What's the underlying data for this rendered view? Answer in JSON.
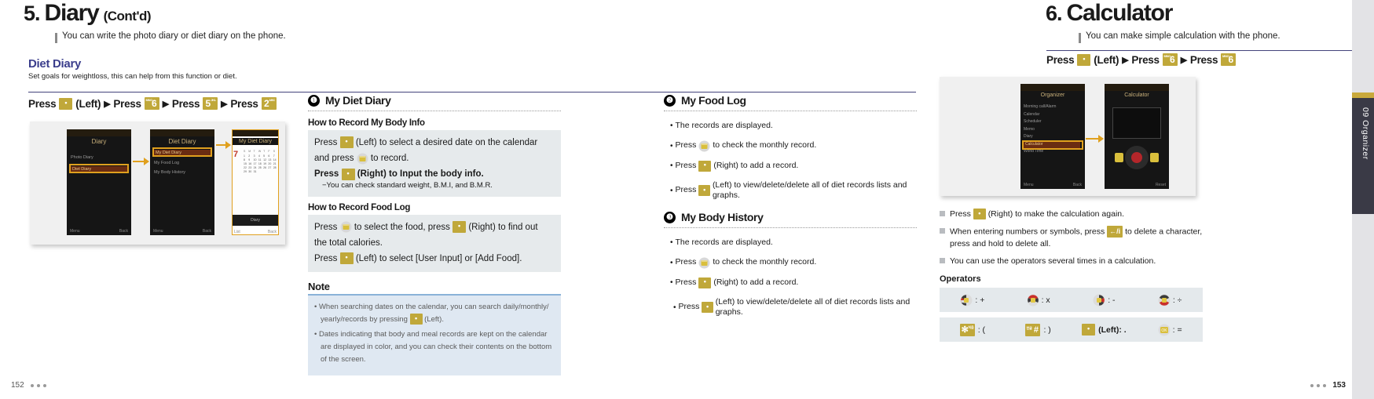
{
  "left": {
    "chapter_number": "5.",
    "chapter_title": "Diary",
    "chapter_cont": "(Cont'd)",
    "intro": "You can write the photo diary or diet diary on the phone.",
    "section_title": "Diet Diary",
    "section_desc": "Set goals for weightloss, this can help from this function or diet.",
    "press_path": {
      "press1": "Press",
      "left_label": "(Left)",
      "press2": "Press",
      "key6": "6",
      "key6_sub": "MNO",
      "press3": "Press",
      "key5": "5",
      "key5_sub": "JKL",
      "press4": "Press",
      "key2": "2",
      "key2_sub": "ABC",
      "arrow": "▶"
    },
    "screens": [
      {
        "title": "Diary",
        "rows": [
          "Photo Diary",
          "Diet Diary"
        ],
        "softkeys": [
          "Menu",
          "Back"
        ]
      },
      {
        "title": "Diet Diary",
        "rows": [
          "My Diet Diary",
          "My Food Log",
          "My Body History"
        ],
        "softkeys": [
          "Menu",
          "Back"
        ]
      },
      {
        "title": "My Diet Diary",
        "rows": [],
        "softkeys": [
          "List",
          "Back"
        ]
      }
    ]
  },
  "col2": {
    "item1": {
      "badge": "❶",
      "label": "My Diet Diary",
      "howto1": "How to Record My Body Info",
      "body1a_pre": "Press",
      "body1a_mid": "(Left) to select a desired date on the calendar and",
      "body1b_pre": "press",
      "body1b_post": "to record.",
      "body1c_pre": "Press",
      "body1c_post": "(Right) to Input the body info.",
      "body1d": "−You can check standard weight, B.M.I, and B.M.R.",
      "howto2": "How to Record Food Log",
      "body2a_pre": "Press",
      "body2a_mid": "to select the food, press",
      "body2a_post": "(Right) to find out",
      "body2a_line2": "the total calories.",
      "body2b_pre": "Press",
      "body2b_post": "(Left) to select [User Input] or [Add Food]."
    },
    "note": {
      "title": "Note",
      "line1": "When searching dates on the calendar, you can search daily/monthly/",
      "line1b_pre": "yearly/records by pressing",
      "line1b_post": "(Left).",
      "line2": "Dates indicating that body and meal records are kept on the calendar are displayed in color, and you can check their contents on the bottom of the screen."
    }
  },
  "col3": {
    "item2": {
      "badge": "❷",
      "label": "My Food Log",
      "lines": [
        {
          "pre": "The records are displayed.",
          "icon": "",
          "post": ""
        },
        {
          "pre": "Press",
          "icon": "nav-icon",
          "post": "to check the monthly record."
        },
        {
          "pre": "Press",
          "icon": "dot-key",
          "post": "(Right) to add a record."
        },
        {
          "pre": "Press",
          "icon": "dot-key",
          "post": "(Left) to view/delete/delete all of diet records lists and graphs."
        }
      ]
    },
    "item3": {
      "badge": "❸",
      "label": "My Body History",
      "lines": [
        {
          "pre": "The records are displayed.",
          "icon": "",
          "post": ""
        },
        {
          "pre": "Press",
          "icon": "nav-icon",
          "post": "to check the monthly record."
        },
        {
          "pre": "Press",
          "icon": "dot-key",
          "post": "(Right) to add a record."
        },
        {
          "pre": "Press",
          "icon": "dot-key",
          "post": "(Left) to view/delete/delete all of diet records lists and graphs."
        }
      ]
    }
  },
  "right": {
    "chapter_number": "6.",
    "chapter_title": "Calculator",
    "intro": "You can make simple calculation with the phone.",
    "press_path": {
      "press1": "Press",
      "left_label": "(Left)",
      "press2": "Press",
      "key6": "6",
      "key6_sub": "MNO",
      "press3": "Press",
      "key6b": "6",
      "key6b_sub": "MNO",
      "arrow": "▶"
    },
    "screens": [
      {
        "title": "Organizer",
        "rows": [
          "Morning call/Alarm",
          "Calendar",
          "Scheduler",
          "Memo",
          "Diary",
          "Calculator",
          "World Time"
        ],
        "softkeys": [
          "Menu",
          "Back"
        ]
      },
      {
        "title": "Calculator",
        "rows": [],
        "softkeys": [
          "",
          "Reset"
        ]
      }
    ],
    "bullets": [
      {
        "pre": "Press",
        "icon": "dot-key",
        "post": "(Right) to make the calculation again."
      },
      {
        "pre": "When entering numbers or symbols, press",
        "icon": "back-key",
        "post": "to delete a character, press and hold to delete all."
      },
      {
        "pre": "You can use the operators several times in a calculation.",
        "icon": "",
        "post": ""
      }
    ],
    "operators_title": "Operators",
    "operators_row1": [
      {
        "icon": "nav-left-icon",
        "label": ": +"
      },
      {
        "icon": "nav-up-icon",
        "label": ": x"
      },
      {
        "icon": "nav-right-icon",
        "label": ": -"
      },
      {
        "icon": "nav-down-icon",
        "label": ": ÷"
      }
    ],
    "operators_row2": [
      {
        "icon": "star-key",
        "label": ": ("
      },
      {
        "icon": "hash-key",
        "label": ": )"
      },
      {
        "icon": "dot-key",
        "label": "(Left): ."
      },
      {
        "icon": "ok-key",
        "label": ": ="
      }
    ],
    "star_key_label": "✻",
    "star_key_sub": "처음",
    "hash_key_label": "#",
    "hash_key_sub": "한글",
    "ok_key_label": "OK"
  },
  "footer": {
    "page_left": "152",
    "page_right": "153"
  },
  "sidetab": {
    "label": "09  Organizer"
  },
  "colors": {
    "gold": "#c0a83a",
    "accent_purple": "#43437c",
    "section_blue": "#3b3e8c",
    "panel_grey": "#e6eaec",
    "note_blue": "#dfe8f2",
    "callout_orange": "#e0a01e"
  }
}
